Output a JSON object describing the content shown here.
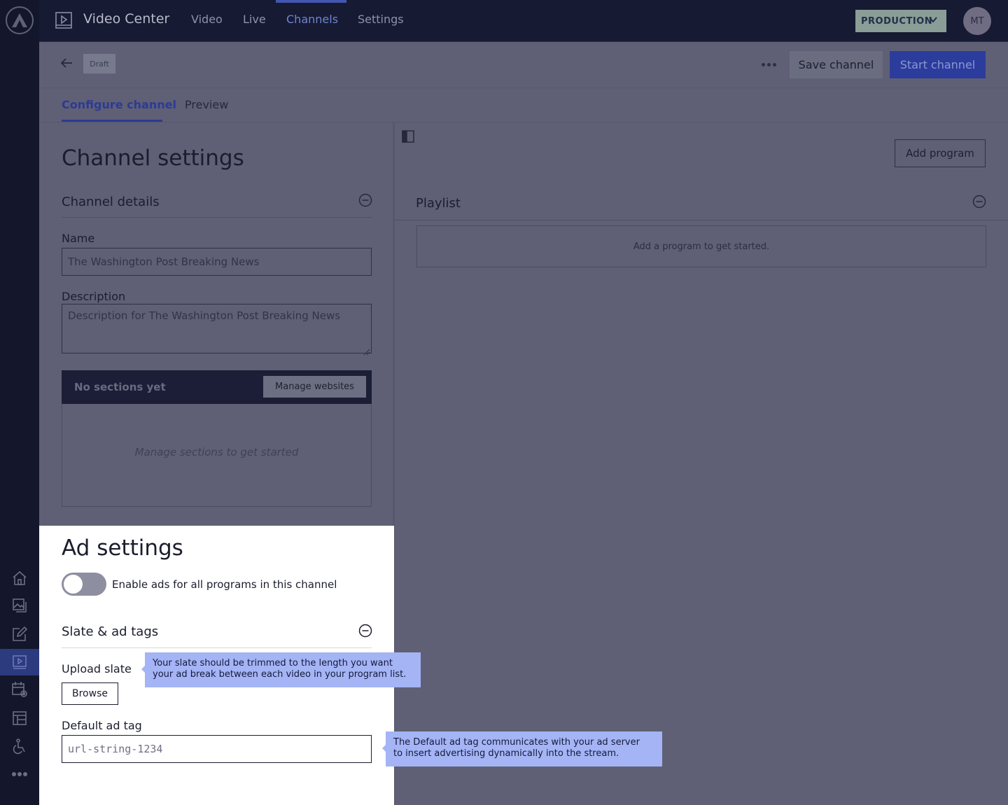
{
  "app": {
    "title": "Video Center",
    "nav": [
      "Video",
      "Live",
      "Channels",
      "Settings"
    ],
    "active_nav": "Channels",
    "environment": "PRODUCTION",
    "user_initials": "MT"
  },
  "header": {
    "status_badge": "Draft",
    "save_label": "Save channel",
    "start_label": "Start channel"
  },
  "tabs": [
    {
      "label": "Configure channel",
      "active": true
    },
    {
      "label": "Preview",
      "active": false
    }
  ],
  "channel_settings": {
    "title": "Channel settings",
    "details_title": "Channel details",
    "name_label": "Name",
    "name_value": "The Washington Post Breaking News",
    "description_label": "Description",
    "description_value": "Description for The Washington Post Breaking News",
    "sections_title": "No sections yet",
    "manage_websites_label": "Manage websites",
    "sections_empty": "Manage sections to get started"
  },
  "playlist": {
    "add_program_label": "Add program",
    "title": "Playlist",
    "empty": "Add a program to get started."
  },
  "ad_settings": {
    "title": "Ad settings",
    "toggle_label": "Enable ads for all programs in this channel",
    "toggle_on": false,
    "slate_title": "Slate & ad tags",
    "upload_label": "Upload slate",
    "browse_label": "Browse",
    "adtag_label": "Default ad tag",
    "adtag_value": "url-string-1234"
  },
  "tooltips": {
    "slate_line1": "Your slate should be trimmed to the length you want",
    "slate_line2": "your ad break between each video in your program list.",
    "adtag_line1": "The Default ad tag communicates with your ad server",
    "adtag_line2": "to insert advertising dynamically into the stream."
  },
  "sidebar_icons": [
    "home-icon",
    "media-icon",
    "edit-icon",
    "video-center-icon",
    "schedule-settings-icon",
    "layout-icon",
    "accessibility-icon",
    "more-icon"
  ],
  "colors": {
    "overlay_bg": "#5f6075",
    "topbar": "#161a33",
    "primary": "#2c3c9d",
    "tooltip": "#a4b4f5",
    "highlight_panel": "#ffffff"
  }
}
